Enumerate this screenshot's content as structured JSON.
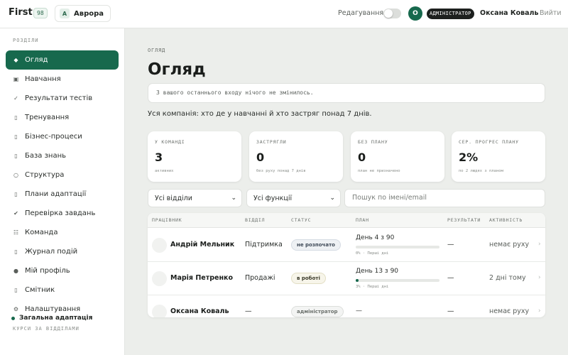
{
  "topbar": {
    "brand": "First",
    "brand_badge": "98",
    "workspace_initial": "А",
    "workspace_name": "Аврора",
    "edit_label": "Редагування",
    "edit_on": false,
    "user_initial": "О",
    "role_badge": "АДМІНІСТРАТОР",
    "user_name": "Оксана Коваль",
    "logout": "Вийти"
  },
  "sidebar": {
    "section_label": "РОЗДІЛИ",
    "items": [
      {
        "label": "Огляд",
        "icon": "diamond-icon",
        "glyph": "◆",
        "active": true
      },
      {
        "label": "Навчання",
        "icon": "book-icon",
        "glyph": "▣",
        "active": false
      },
      {
        "label": "Результати тестів",
        "icon": "check-icon",
        "glyph": "✓",
        "active": false
      },
      {
        "label": "Тренування",
        "icon": "document-icon",
        "glyph": "▯",
        "active": false
      },
      {
        "label": "Бізнес-процеси",
        "icon": "document-icon",
        "glyph": "▯",
        "active": false
      },
      {
        "label": "База знань",
        "icon": "document-icon",
        "glyph": "▯",
        "active": false
      },
      {
        "label": "Структура",
        "icon": "circle-icon",
        "glyph": "○",
        "active": false
      },
      {
        "label": "Плани адаптації",
        "icon": "document-icon",
        "glyph": "▯",
        "active": false
      },
      {
        "label": "Перевірка завдань",
        "icon": "checkmark-icon",
        "glyph": "✔",
        "active": false
      },
      {
        "label": "Команда",
        "icon": "grid-icon",
        "glyph": "☷",
        "active": false
      },
      {
        "label": "Журнал подій",
        "icon": "document-icon",
        "glyph": "▯",
        "active": false
      },
      {
        "label": "Мій профіль",
        "icon": "dot-icon",
        "glyph": "●",
        "active": false
      },
      {
        "label": "Смітник",
        "icon": "document-icon",
        "glyph": "▯",
        "active": false
      },
      {
        "label": "Налаштування",
        "icon": "gear-icon",
        "glyph": "⚙",
        "active": false
      }
    ],
    "courses_label": "КУРСИ ЗА ВІДДІЛАМИ",
    "course_item": "Загальна адаптація"
  },
  "main": {
    "breadcrumb": "ОГЛЯД",
    "title": "Огляд",
    "notice": "З вашого останнього входу нічого не змінилось.",
    "subtitle": "Уся компанія: хто де у навчанні й хто застряг понад 7 днів.",
    "stats": [
      {
        "label": "У КОМАНДІ",
        "value": "3",
        "sub": "активних"
      },
      {
        "label": "ЗАСТРЯГЛИ",
        "value": "0",
        "sub": "без руху понад 7 днів"
      },
      {
        "label": "БЕЗ ПЛАНУ",
        "value": "0",
        "sub": "план не призначено"
      },
      {
        "label": "СЕР. ПРОГРЕС ПЛАНУ",
        "value": "2%",
        "sub": "по 2 людях з планом"
      }
    ],
    "filters": {
      "department": "Усі відділи",
      "function": "Усі функції",
      "search_placeholder": "Пошук по імені/email"
    },
    "table": {
      "headers": [
        "ПРАЦІВНИК",
        "ВІДДІЛ",
        "СТАТУС",
        "ПЛАН",
        "РЕЗУЛЬТАТИ",
        "АКТИВНІСТЬ"
      ],
      "rows": [
        {
          "name": "Андрій Мельник",
          "department": "Підтримка",
          "status": "не розпочато",
          "status_kind": "none",
          "plan": "День 4 з 90",
          "progress": 0,
          "plan_sub": "0% · Перші дні",
          "results": "—",
          "activity": "немає руху"
        },
        {
          "name": "Марія Петренко",
          "department": "Продажі",
          "status": "в роботі",
          "status_kind": "work",
          "plan": "День 13 з 90",
          "progress": 3,
          "plan_sub": "3% · Перші дні",
          "results": "—",
          "activity": "2 дні тому"
        },
        {
          "name": "Оксана Коваль",
          "department": "—",
          "status": "адміністратор",
          "status_kind": "admin",
          "plan": "—",
          "progress": null,
          "plan_sub": "",
          "results": "—",
          "activity": "немає руху"
        }
      ]
    }
  },
  "colors": {
    "accent": "#17694d",
    "background": "#eceeeb",
    "role_badge": "#1d201e"
  }
}
